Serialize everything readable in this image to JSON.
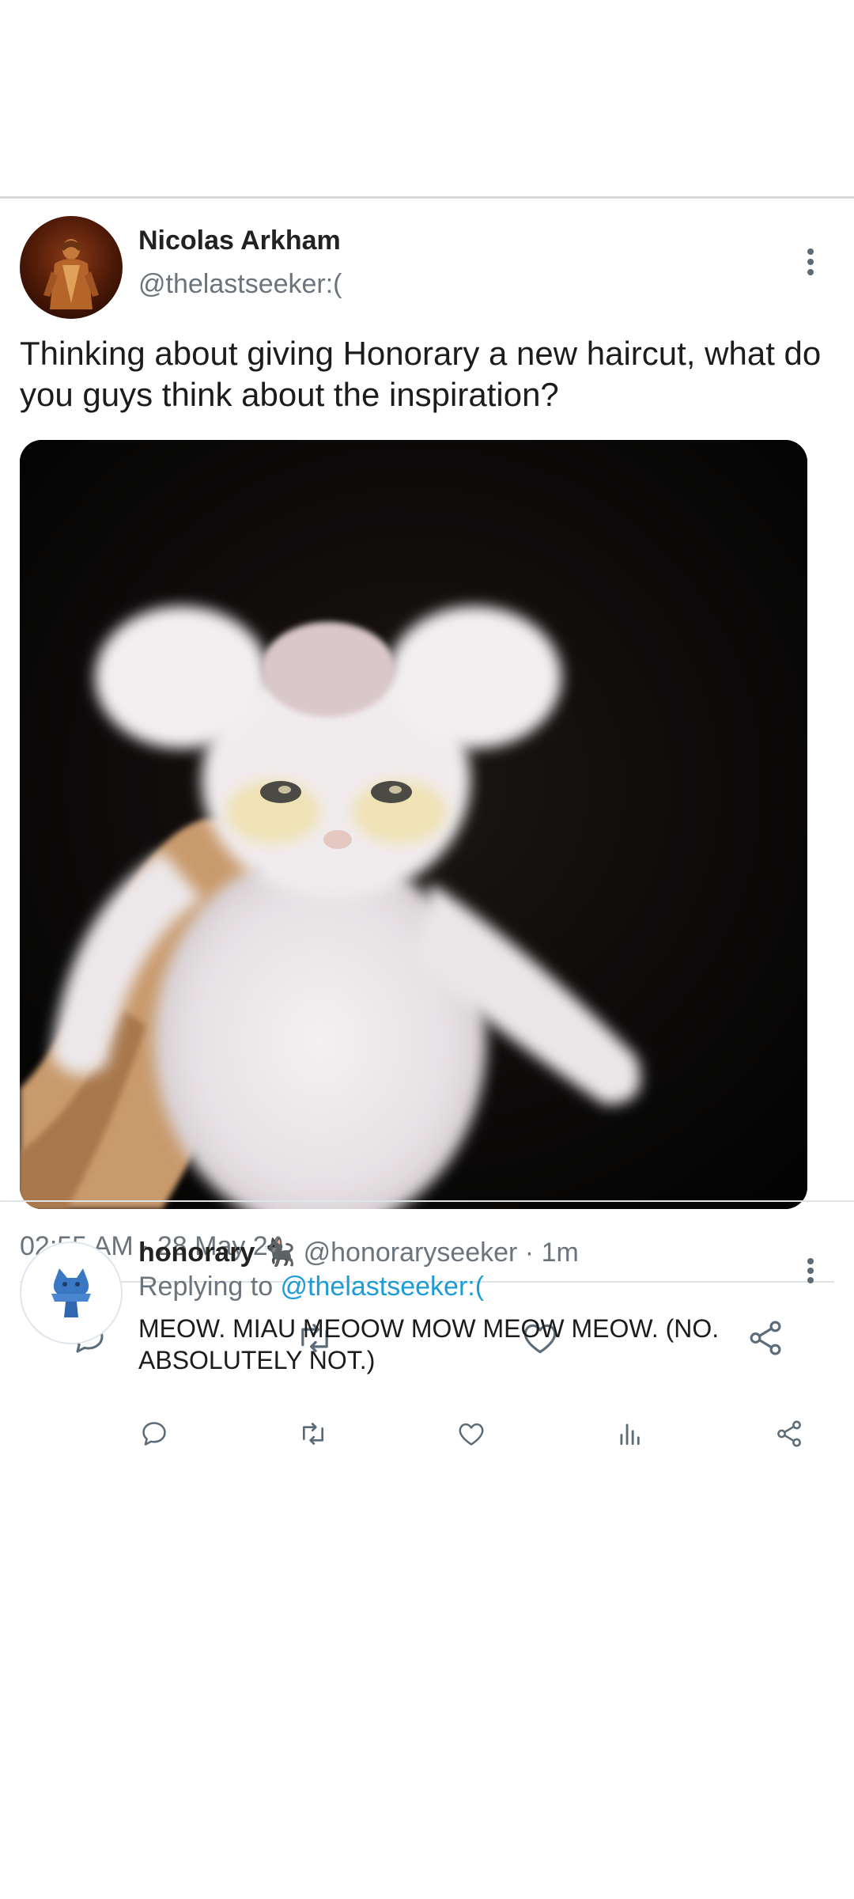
{
  "tweet": {
    "author_name": "Nicolas Arkham",
    "author_handle": "@thelastseeker:(",
    "text": "Thinking about giving Honorary a new haircut, what do you guys think about the inspiration?",
    "media_subject": "fluffy white kitten held by a hand against a black background",
    "timestamp": "02:55 AM · 28 May 24",
    "actions": [
      "reply-icon",
      "retweet-icon",
      "like-icon",
      "share-icon"
    ]
  },
  "reply": {
    "author_name": "honorary",
    "name_emoji": "🐈‍⬛",
    "author_handle": "@honoraryseeker · 1m",
    "replying_prefix": "Replying to ",
    "replying_to": "@thelastseeker:(",
    "text": "MEOW. MIAU MEOOW MOW MEOW MEOW. (NO. ABSOLUTELY NOT.)",
    "actions": [
      "reply-icon",
      "retweet-icon",
      "like-icon",
      "views-icon",
      "share-icon"
    ]
  },
  "colors": {
    "handle_gray": "#6b747d",
    "mention_blue": "#1d9bd6",
    "icon_gray": "#5b6b78",
    "divider": "#e1e4e6"
  }
}
